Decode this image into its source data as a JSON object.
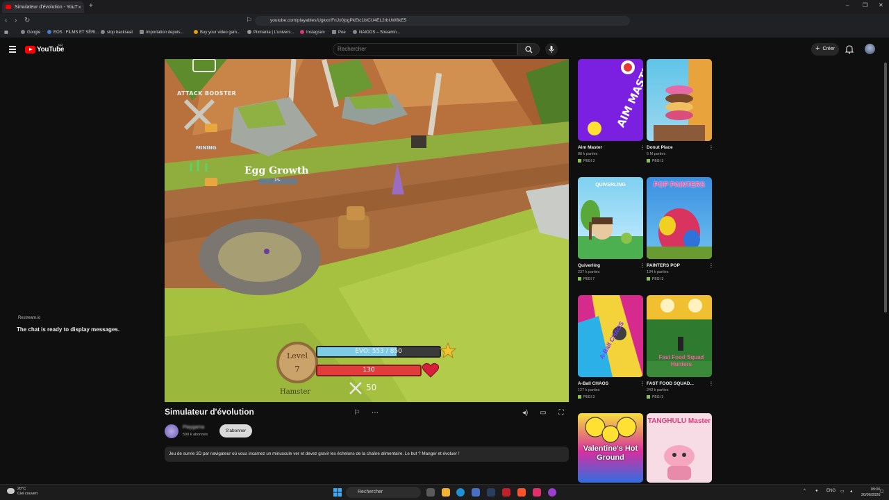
{
  "browser": {
    "tab_title": "Simulateur d'évolution - YouT",
    "url": "youtube.com/playables/Ugkxx!FnJx0jogPkEtc1blCU4EL2rbUW8kE5",
    "bookmarks": [
      "Google",
      "EOS : FILMS ET SÉRI...",
      "stop backseat",
      "Importation depuis...",
      "Buy your video gam...",
      "Pixmania | L'univers...",
      "Instagram",
      "Poe",
      "NAIOOS – Streamin..."
    ]
  },
  "youtube": {
    "logo_text": "YouTube",
    "region": "FR",
    "search_placeholder": "Rechercher",
    "create_label": "Créer"
  },
  "chat": {
    "source": "Restream.io",
    "message": "The chat is ready to display messages."
  },
  "game": {
    "booster_label": "ATTACK BOOSTER",
    "mining_label": "MINING",
    "egg_label": "Egg Growth",
    "egg_percent": "1%",
    "player_name": "Hamster",
    "level_label": "Level",
    "level_value": "7",
    "evo_text": "EVO: 553 / 850",
    "evo_fraction": 0.65,
    "health_text": "130",
    "attack_value": "50"
  },
  "video": {
    "title": "Simulateur d'évolution",
    "channel_name": "Playgama",
    "subscribers": "590 k abonnés",
    "subscribe_label": "S'abonner",
    "description": "Jeu de survie 3D par navigateur où vous incarnez un minuscule ver et devez gravir les échelons de la chaîne alimentaire. Le but ? Manger et évoluer !"
  },
  "related": [
    {
      "title": "Aim Master",
      "plays": "88 k parties",
      "pegi": "PEGI 3",
      "thumb_text": "AIM MASTER"
    },
    {
      "title": "Donut Place",
      "plays": "5 M parties",
      "pegi": "PEGI 3",
      "thumb_text": ""
    },
    {
      "title": "Quiverling",
      "plays": "237 k parties",
      "pegi": "PEGI 7",
      "thumb_text": "QUIVERLING"
    },
    {
      "title": "PAINTERS POP",
      "plays": "134 k parties",
      "pegi": "PEGI 3",
      "thumb_text": "POP PAINTERS"
    },
    {
      "title": "A-Ball CHAOS",
      "plays": "127 k parties",
      "pegi": "PEGI 3",
      "thumb_text": "A-Ball CHAOS"
    },
    {
      "title": "FAST FOOD SQUAD...",
      "plays": "243 k parties",
      "pegi": "PEGI 3",
      "thumb_text": "Fast Food Squad Hunters"
    },
    {
      "title": "",
      "plays": "",
      "pegi": "",
      "thumb_text": "Valentine's Hot Ground"
    },
    {
      "title": "",
      "plays": "",
      "pegi": "",
      "thumb_text": "TANGHULU Master"
    }
  ],
  "taskbar": {
    "temperature": "20°C",
    "weather": "Ciel couvert",
    "search_label": "Rechercher",
    "lang": "ENG",
    "time": "09:06",
    "date": "20/06/2026"
  },
  "colors": {
    "accent": "#ff0000",
    "bg": "#0f0f0f",
    "evo_bar": "#7ecbe6",
    "health_bar": "#e23b3b"
  }
}
